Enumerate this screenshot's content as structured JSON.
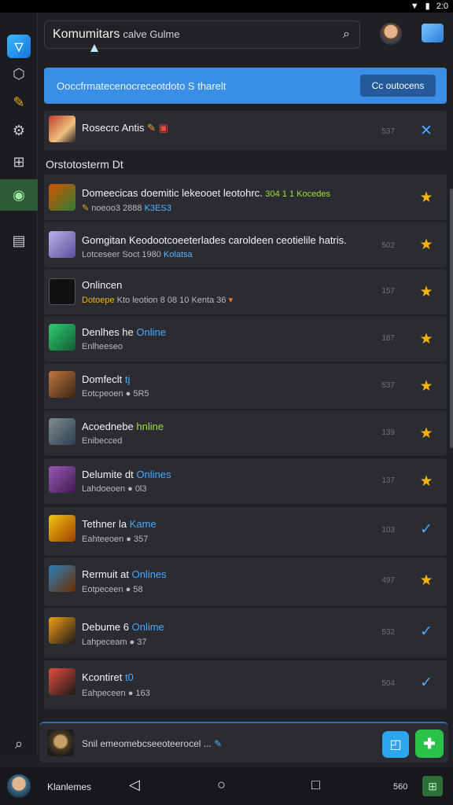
{
  "status_bar": {
    "time": "2:0"
  },
  "search": {
    "value": "Komumitars",
    "value_suffix": "calve Gulme"
  },
  "banner": {
    "text": "Ooccfrmatecenocreceotdoto S tharelt",
    "button_label": "Cc outocens"
  },
  "pinned": {
    "title": "Rosecrc Antis",
    "num": "537"
  },
  "section_title": "Orstotosterm Dt",
  "items": [
    {
      "title": "Domeecicas doemitic lekeooet leotohrc.",
      "title_extra": "304 1 1 Kocedes",
      "sub": "noeoo3 2888",
      "sub_tag": "K3ES3",
      "num": "",
      "action": "star"
    },
    {
      "title": "Gomgitan Keodootcoeeterlades caroldeen ceotielile hatris.",
      "sub": "Lotceseer Soct 1980",
      "sub_tag": "Kolatsa",
      "num": "502",
      "action": "star"
    },
    {
      "title": "Onlincen",
      "sub_y": "Dotoepe",
      "sub": "Kto leotion 8 08 10 Kenta 36",
      "num": "157",
      "action": "star"
    },
    {
      "title": "Denlhes he",
      "title_hl": "Online",
      "sub": "Enlheeseo",
      "num": "187",
      "action": "star"
    },
    {
      "title": "Domfeclt",
      "title_hl": "tj",
      "sub": "Eotcpeoen ● 5R5",
      "num": "537",
      "action": "star"
    },
    {
      "title": "Acoednebe",
      "title_hl": "hnline",
      "sub": "Enibecced",
      "num": "139",
      "action": "star"
    },
    {
      "title": "Delumite dt",
      "title_hl": "Onlines",
      "sub": "Lahdoeoen ● 0l3",
      "num": "137",
      "action": "star"
    },
    {
      "title": "Tethner la",
      "title_hl": "Kame",
      "sub": "Eahteeoen ● 357",
      "num": "103",
      "action": "check"
    },
    {
      "title": "Rermuit at",
      "title_hl": "Onlines",
      "sub": "Eotpeceen ● 58",
      "num": "497",
      "action": "star"
    },
    {
      "title": "Debume 6",
      "title_hl": "Onlime",
      "sub": "Lahpeceam ● 37",
      "num": "532",
      "action": "check"
    },
    {
      "title": "Kcontiret",
      "title_hl": "t0",
      "sub": "Eahpeceen ● 163",
      "num": "504",
      "action": "check"
    }
  ],
  "composer": {
    "text": "Snil emeomebcseeoteerocel ..."
  },
  "bottom": {
    "label": "Klanlemes",
    "count": "560"
  },
  "colors": {
    "accent": "#3a8ee6",
    "star": "#f5b40c",
    "online": "#4aa8ff",
    "green": "#2bc24a"
  }
}
